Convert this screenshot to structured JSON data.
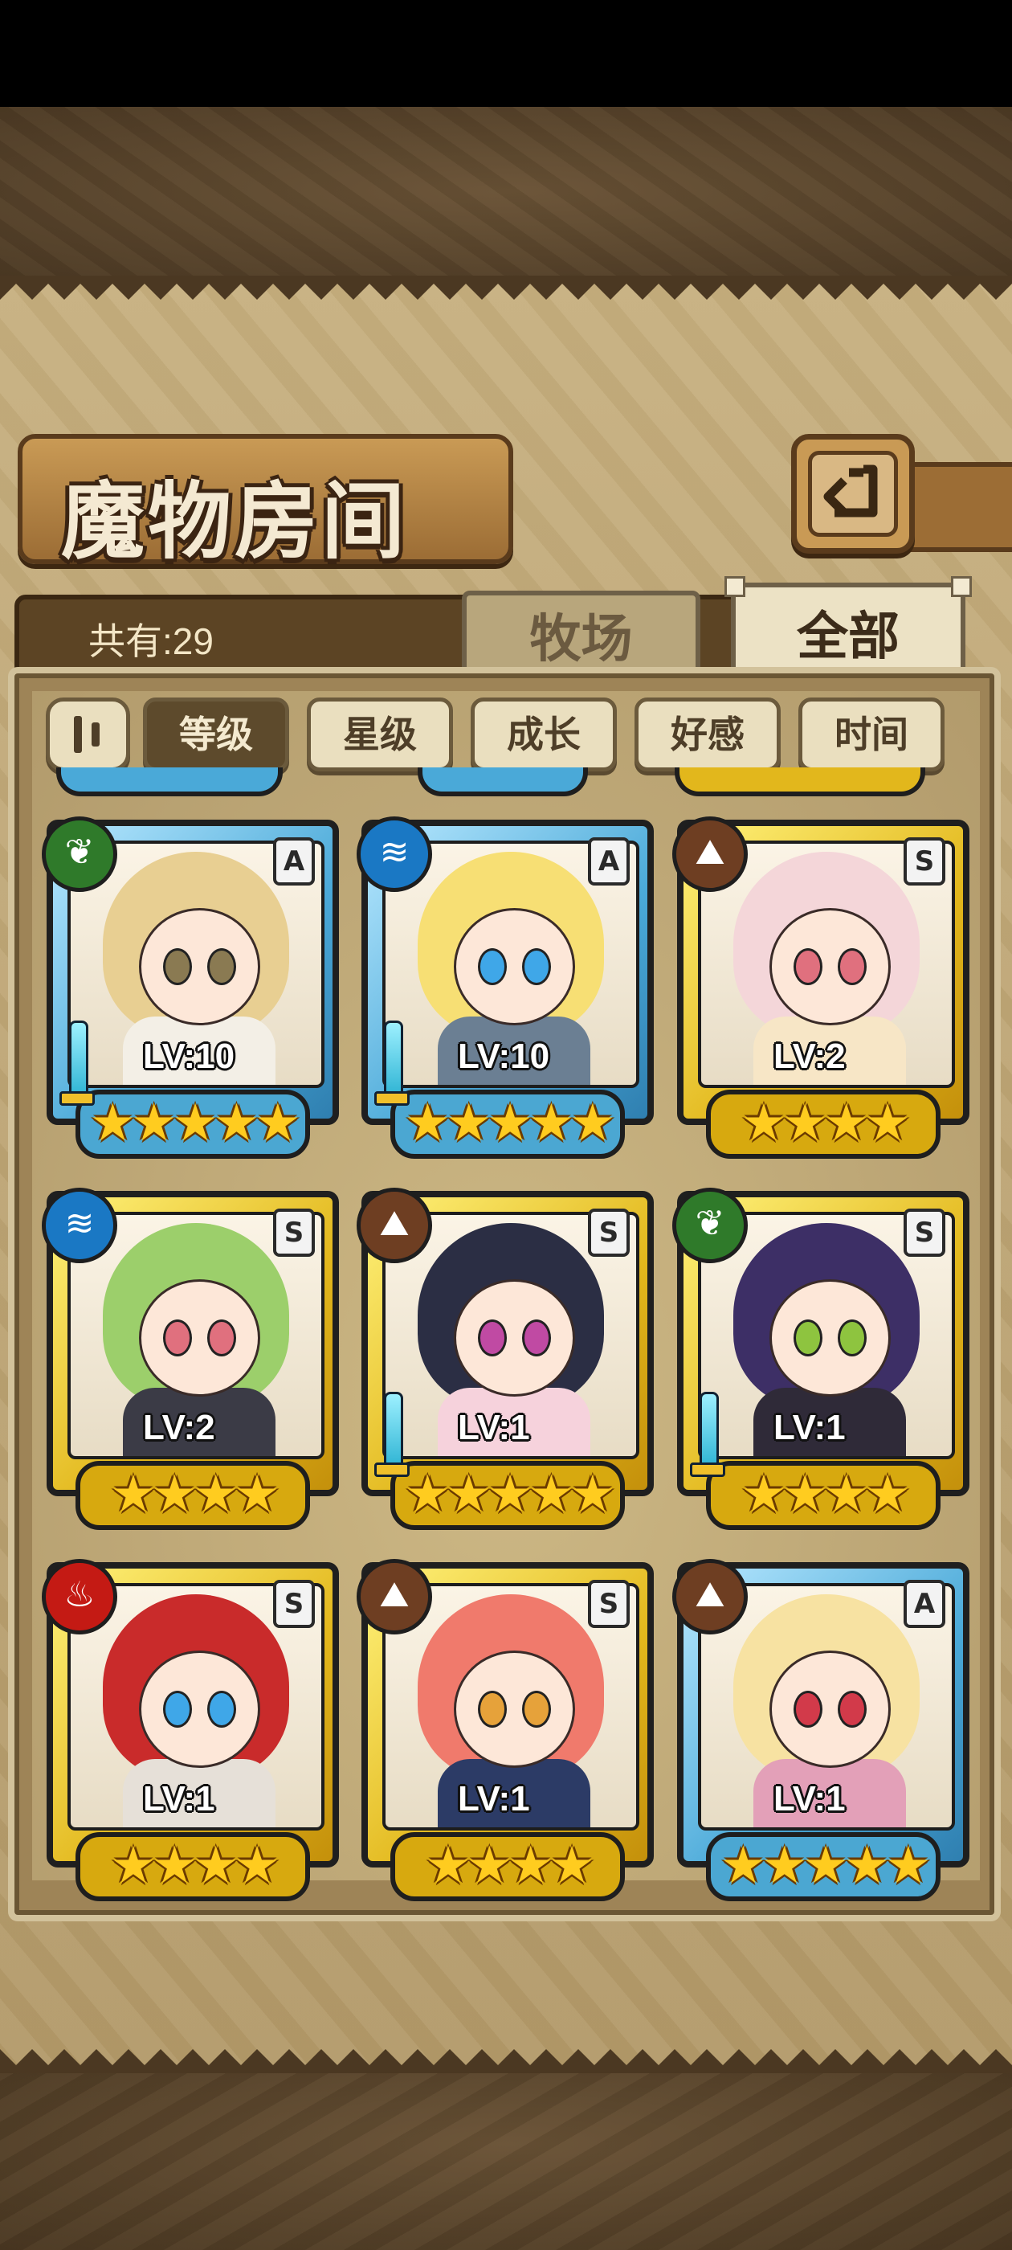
{
  "screen": {
    "title": "魔物房间",
    "count_label": "共有:29",
    "tabs": [
      {
        "label": "牧场",
        "active": false
      },
      {
        "label": "全部",
        "active": true
      }
    ],
    "filters": [
      {
        "label": "等级",
        "active": true
      },
      {
        "label": "星级",
        "active": false
      },
      {
        "label": "成长",
        "active": false
      },
      {
        "label": "好感",
        "active": false
      },
      {
        "label": "时间",
        "active": false
      }
    ],
    "back_icon": "back-return-icon",
    "sort_toggle_icon": "sort-order-icon"
  },
  "colors": {
    "gold_frame": "#e2b71c",
    "blue_frame": "#4aa9d8",
    "grass": "#2f7a2a",
    "water": "#1a78c4",
    "earth": "#6e3e22",
    "fire": "#c41a14"
  },
  "monsters": [
    {
      "level": "LV:10",
      "grade": "A",
      "element": "grass",
      "element_glyph": "❦",
      "stars": "★★★★★",
      "frame": "blue",
      "weapon": true,
      "hair": "#e8cf92",
      "body": "#f3efe6",
      "eye": "#8a7a52"
    },
    {
      "level": "LV:10",
      "grade": "A",
      "element": "water",
      "element_glyph": "≋",
      "stars": "★★★★★",
      "frame": "blue",
      "weapon": true,
      "hair": "#f7df74",
      "body": "#6b7f93",
      "eye": "#3fa7e8"
    },
    {
      "level": "LV:2",
      "grade": "S",
      "element": "earth",
      "element_glyph": "⛰",
      "stars": "★★★★",
      "frame": "gold",
      "weapon": false,
      "hair": "#f4d6d9",
      "body": "#f7e6c6",
      "eye": "#e0707e"
    },
    {
      "level": "LV:2",
      "grade": "S",
      "element": "water",
      "element_glyph": "≋",
      "stars": "★★★★",
      "frame": "gold",
      "weapon": false,
      "hair": "#9ccf6b",
      "body": "#3b3b46",
      "eye": "#e0707e"
    },
    {
      "level": "LV:1",
      "grade": "S",
      "element": "earth",
      "element_glyph": "⛰",
      "stars": "★★★★★",
      "frame": "gold",
      "weapon": true,
      "hair": "#2b2e44",
      "body": "#f6d2dc",
      "eye": "#c04aa3"
    },
    {
      "level": "LV:1",
      "grade": "S",
      "element": "grass",
      "element_glyph": "❦",
      "stars": "★★★★",
      "frame": "gold",
      "weapon": true,
      "hair": "#3d2f66",
      "body": "#2f2a38",
      "eye": "#8ec43f"
    },
    {
      "level": "LV:1",
      "grade": "S",
      "element": "fire",
      "element_glyph": "♨",
      "stars": "★★★★",
      "frame": "gold",
      "weapon": false,
      "hair": "#c92b2b",
      "body": "#e6e0d8",
      "eye": "#3fa7e8"
    },
    {
      "level": "LV:1",
      "grade": "S",
      "element": "earth",
      "element_glyph": "⛰",
      "stars": "★★★★",
      "frame": "gold",
      "weapon": false,
      "hair": "#f07a6c",
      "body": "#2c3b66",
      "eye": "#e6a23a"
    },
    {
      "level": "LV:1",
      "grade": "A",
      "element": "earth",
      "element_glyph": "⛰",
      "stars": "★★★★★",
      "frame": "blue",
      "weapon": false,
      "hair": "#f7e2a2",
      "body": "#e3a0b8",
      "eye": "#d23a4a"
    }
  ]
}
